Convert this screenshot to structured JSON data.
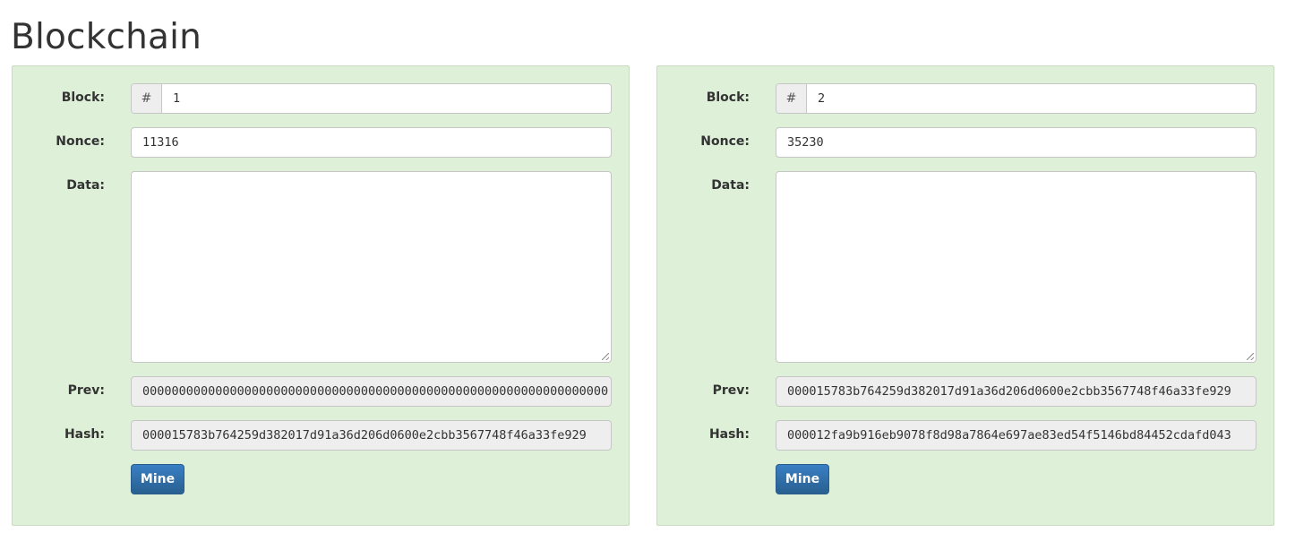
{
  "page": {
    "title": "Blockchain"
  },
  "labels": {
    "block": "Block:",
    "nonce": "Nonce:",
    "data": "Data:",
    "prev": "Prev:",
    "hash": "Hash:",
    "block_prefix": "#",
    "mine_button": "Mine"
  },
  "blocks": [
    {
      "number": "1",
      "nonce": "11316",
      "data": "",
      "prev": "0000000000000000000000000000000000000000000000000000000000000000",
      "hash": "000015783b764259d382017d91a36d206d0600e2cbb3567748f46a33fe929"
    },
    {
      "number": "2",
      "nonce": "35230",
      "data": "",
      "prev": "000015783b764259d382017d91a36d206d0600e2cbb3567748f46a33fe929",
      "hash": "000012fa9b916eb9078f8d98a7864e697ae83ed54f5146bd84452cdafd043"
    }
  ],
  "colors": {
    "card_background": "#dff0d8",
    "button_primary": "#286090",
    "readonly_field": "#eeeeee"
  }
}
